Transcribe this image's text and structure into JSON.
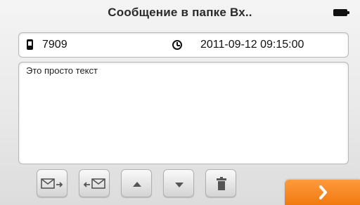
{
  "header": {
    "title": "Сообщение в папке Вх..",
    "battery_icon": "battery-icon"
  },
  "message": {
    "sender": "7909",
    "datetime": "2011-09-12 09:15:00",
    "body": "Это просто текст"
  },
  "toolbar": {
    "buttons": [
      {
        "icon": "reply-icon"
      },
      {
        "icon": "forward-icon"
      },
      {
        "icon": "arrow-up-icon"
      },
      {
        "icon": "arrow-down-icon"
      },
      {
        "icon": "trash-icon"
      }
    ],
    "next_icon": "chevron-right-icon"
  },
  "colors": {
    "accent": "#f5811f",
    "icon": "#555555"
  }
}
